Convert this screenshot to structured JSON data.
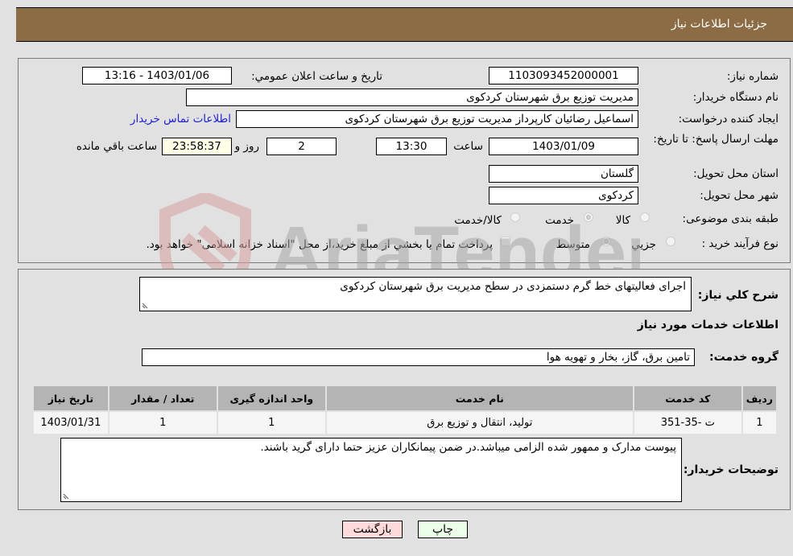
{
  "header": {
    "title": "جزئیات اطلاعات نیاز"
  },
  "form": {
    "need_number": {
      "label": "شماره نیاز:",
      "value": "1103093452000001"
    },
    "announce_datetime": {
      "label": "تاریخ و ساعت اعلان عمومي:",
      "value": "1403/01/06 - 13:16"
    },
    "buyer_org": {
      "label": "نام دستگاه خريدار:",
      "value": "مدیریت توزیع برق شهرستان کردکوی"
    },
    "requester": {
      "label": "ايجاد كننده درخواست:",
      "value": "اسماعیل رضائیان کارپرداز مدیریت توزیع برق شهرستان کردکوی",
      "contact_link": "اطلاعات تماس خريدار"
    },
    "deadline": {
      "label": "مهلت ارسال پاسخ: تا تاريخ:",
      "date": "1403/01/09",
      "time_label": "ساعت",
      "time": "13:30",
      "days": "2",
      "days_label": "روز و",
      "remaining": "23:58:37",
      "remaining_label": "ساعت باقي مانده"
    },
    "province": {
      "label": "استان محل تحويل:",
      "value": "گلستان"
    },
    "city": {
      "label": "شهر محل تحويل:",
      "value": "کردکوی"
    },
    "category": {
      "label": "طبقه بندی موضوعی:",
      "options": [
        {
          "label": "کالا",
          "selected": false
        },
        {
          "label": "خدمت",
          "selected": true
        },
        {
          "label": "کالا/خدمت",
          "selected": false
        }
      ]
    },
    "purchase_type": {
      "label": "نوع فرآيند خريد :",
      "options": [
        {
          "label": "جزيي",
          "selected": false
        },
        {
          "label": "متوسط",
          "selected": true
        }
      ],
      "treasury_note": "پرداخت تمام يا بخشي از مبلغ خريد،از محل \"اسناد خزانه اسلامی\" خواهد بود.",
      "treasury_checked": false
    }
  },
  "details": {
    "description_label": "شرح كلي نياز:",
    "description": "اجرای فعالیتهای خط گرم دستمزدی در سطح مدیریت برق شهرستان کردکوی",
    "services_heading": "اطلاعات خدمات مورد نياز",
    "service_group_label": "گروه خدمت:",
    "service_group": "تامین برق، گاز، بخار و تهویه هوا",
    "table": {
      "headers": [
        "رديف",
        "کد خدمت",
        "نام خدمت",
        "واحد اندازه گيری",
        "تعداد / مقدار",
        "تاريخ نياز"
      ],
      "rows": [
        [
          "1",
          "ت -35-351",
          "تولید، انتقال و توزیع برق",
          "1",
          "1",
          "1403/01/31"
        ]
      ]
    },
    "buyer_notes_label": "توضيحات خريدار:",
    "buyer_notes": "پیوست مدارک و ممهور شده الزامی میباشد.در ضمن پیمانکاران عزیز حتما دارای گرید باشند."
  },
  "buttons": {
    "print": "چاپ",
    "back": "بازگشت"
  },
  "watermark": {
    "text": "AriaTender.neT"
  },
  "colors": {
    "header_bg": "#8c6c44",
    "link": "#1f1fd0",
    "print_bg": "#ecffe8",
    "back_bg": "#ffdada"
  }
}
